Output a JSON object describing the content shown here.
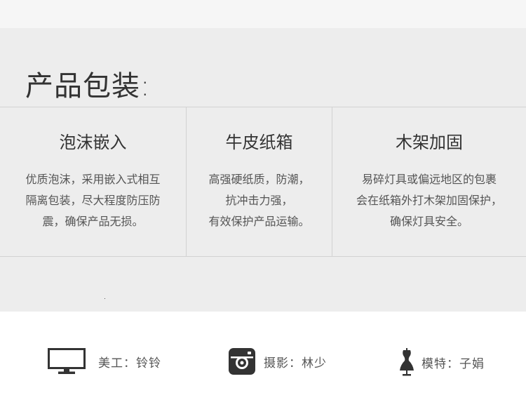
{
  "packaging": {
    "title": "产品包装:",
    "features": [
      {
        "title": "泡沫嵌入",
        "lines": [
          "优质泡沫，采用嵌入式相互",
          "隔离包装，尽大程度防压防",
          "震，确保产品无损。"
        ]
      },
      {
        "title": "牛皮纸箱",
        "lines": [
          "高强硬纸质，防潮，",
          "抗冲击力强，",
          "有效保护产品运输。"
        ]
      },
      {
        "title": "木架加固",
        "lines": [
          "易碎灯具或偏远地区的包裹",
          "会在纸箱外打木架加固保护，",
          "确保灯具安全。"
        ]
      }
    ]
  },
  "credits": [
    {
      "icon": "monitor-icon",
      "text": "美工：铃铃"
    },
    {
      "icon": "camera-icon",
      "text": "摄影：林少"
    },
    {
      "icon": "mannequin-icon",
      "text": "模特：子娟"
    }
  ],
  "colors": {
    "panel_bg": "#ededed",
    "top_strip_bg": "#f6f6f6",
    "divider": "#d2d2d2",
    "icon": "#333333"
  }
}
